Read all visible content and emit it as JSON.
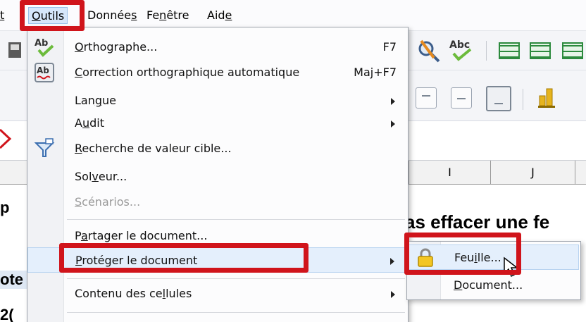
{
  "menubar": {
    "items": [
      {
        "pre": "",
        "acc": "t",
        "post": ""
      },
      {
        "pre": "",
        "acc": "O",
        "post": "utils"
      },
      {
        "pre": "Donnée",
        "acc": "s",
        "post": ""
      },
      {
        "pre": "Fe",
        "acc": "n",
        "post": "être"
      },
      {
        "pre": "Aid",
        "acc": "e",
        "post": ""
      }
    ]
  },
  "columns": [
    "I",
    "J"
  ],
  "sheet": {
    "heading_fragment": "as effacer une fe",
    "left_fragments": [
      "p",
      "ote",
      "2("
    ]
  },
  "menu": {
    "items": [
      {
        "pre": "",
        "acc": "O",
        "post": "rthographe...",
        "shortcut": "F7",
        "icon": "spellcheck-icon"
      },
      {
        "pre": "",
        "acc": "C",
        "post": "orrection orthographique automatique",
        "shortcut": "Maj+F7",
        "icon": "autospellcheck-icon"
      },
      {
        "pre": "Lan",
        "acc": "g",
        "post": "ue",
        "submenu": true
      },
      {
        "pre": "A",
        "acc": "u",
        "post": "dit",
        "submenu": true
      },
      {
        "pre": "",
        "acc": "R",
        "post": "echerche de valeur cible...",
        "icon": "goal-seek-icon"
      },
      {
        "pre": "Sol",
        "acc": "v",
        "post": "eur..."
      },
      {
        "pre": "",
        "acc": "S",
        "post": "cénarios...",
        "disabled": true
      },
      {
        "pre": "P",
        "acc": "a",
        "post": "rtager le document..."
      },
      {
        "pre": "",
        "acc": "P",
        "post": "rotéger le document",
        "submenu": true,
        "highlighted": true
      },
      {
        "pre": "Contenu des ce",
        "acc": "l",
        "post": "lules",
        "submenu": true
      }
    ]
  },
  "submenu": {
    "items": [
      {
        "pre": "Feu",
        "acc": "i",
        "post": "lle...",
        "icon": "lock-icon",
        "highlighted": true
      },
      {
        "pre": "",
        "acc": "D",
        "post": "ocument..."
      }
    ]
  },
  "colors": {
    "annotation_red": "#d0141b",
    "highlight": "#e4effc"
  }
}
